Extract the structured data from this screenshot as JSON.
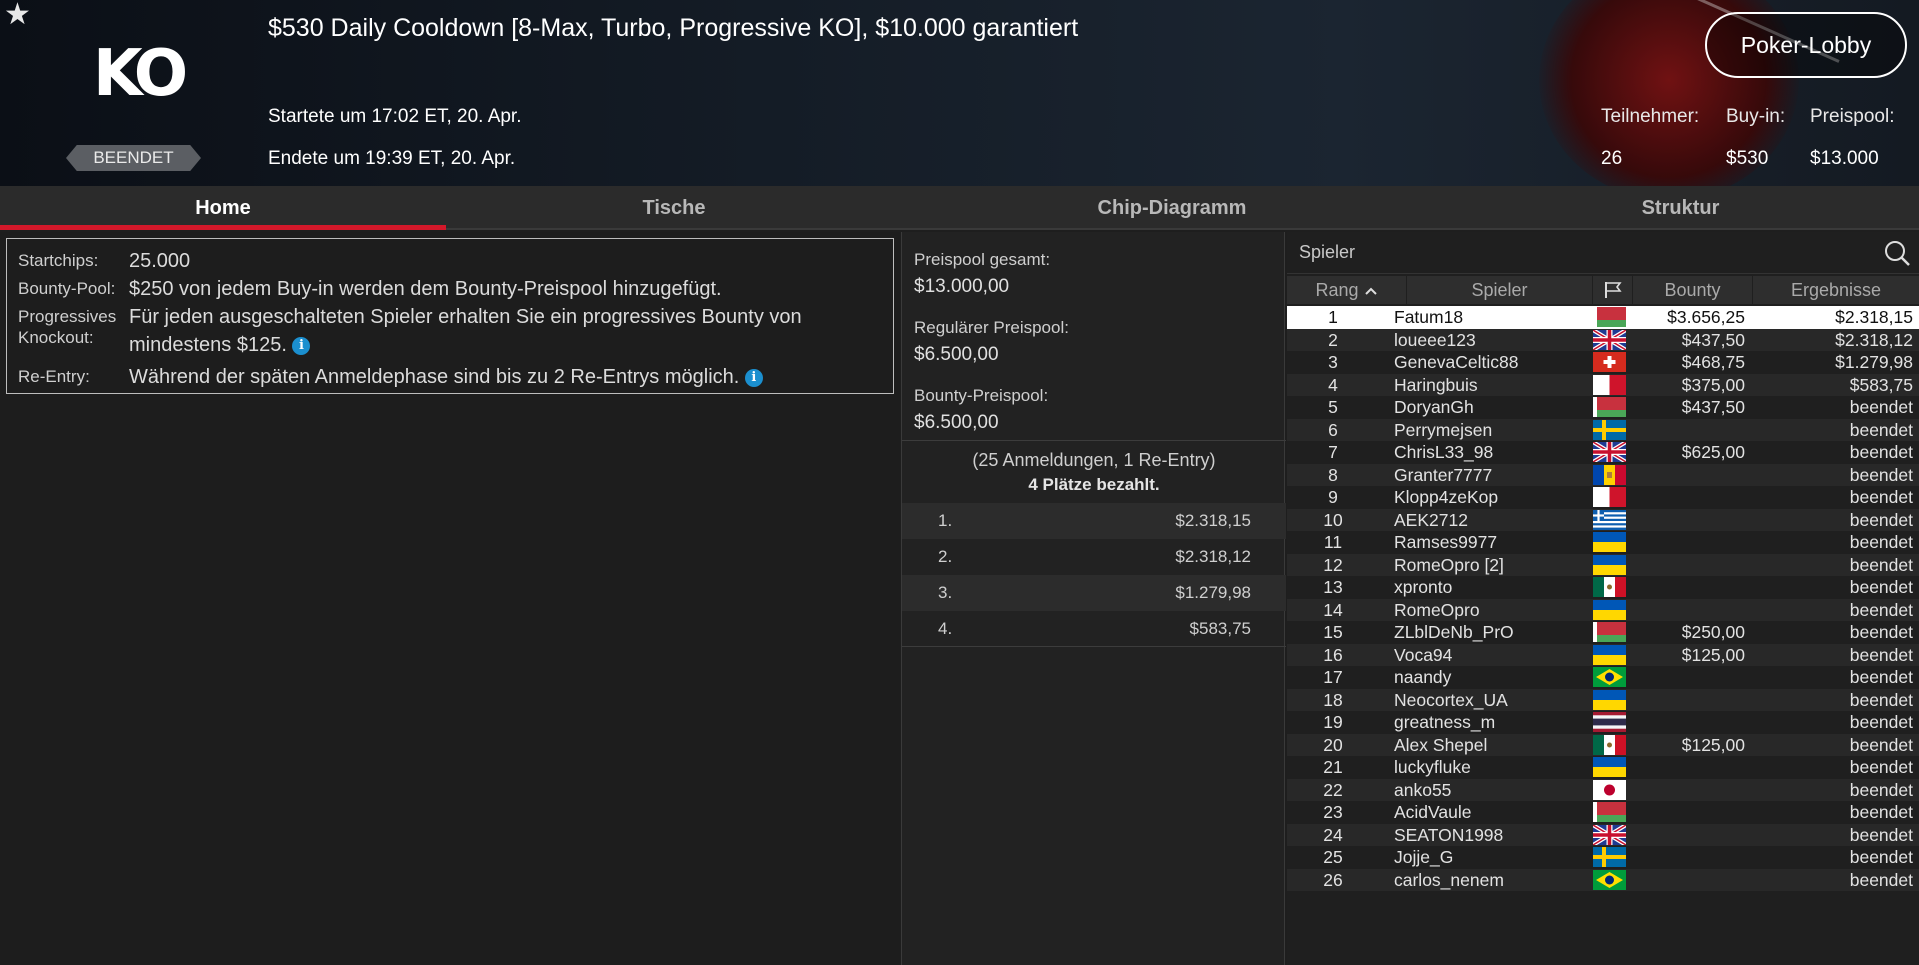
{
  "header": {
    "title": "$530 Daily Cooldown [8-Max, Turbo, Progressive KO], $10.000 garantiert",
    "logo_text": "KO",
    "status_badge": "BEENDET",
    "started": "Startete um 17:02 ET, 20. Apr.",
    "ended": "Endete um 19:39 ET, 20. Apr.",
    "lobby_button": "Poker-Lobby",
    "stats": {
      "participants_label": "Teilnehmer:",
      "participants_value": "26",
      "buyin_label": "Buy-in:",
      "buyin_value": "$530",
      "prizepool_label": "Preispool:",
      "prizepool_value": "$13.000"
    }
  },
  "tabs": [
    "Home",
    "Tische",
    "Chip-Diagramm",
    "Struktur"
  ],
  "info": {
    "startchips_label": "Startchips:",
    "startchips_value": "25.000",
    "bountypool_label": "Bounty-Pool:",
    "bountypool_value": "$250 von jedem Buy-in werden dem Bounty-Preispool hinzugefügt.",
    "pko_label_1": "Progressives",
    "pko_label_2": "Knockout:",
    "pko_value": "Für jeden ausgeschalteten Spieler erhalten Sie ein progressives Bounty von mindestens $125.",
    "reentry_label": "Re-Entry:",
    "reentry_value": "Während der späten Anmeldephase sind bis zu 2 Re-Entrys möglich.",
    "info_icon": "i"
  },
  "prizepool": {
    "total_label": "Preispool gesamt:",
    "total_value": "$13.000,00",
    "regular_label": "Regulärer Preispool:",
    "regular_value": "$6.500,00",
    "bounty_label": "Bounty-Preispool:",
    "bounty_value": "$6.500,00",
    "entries": "(25 Anmeldungen, 1 Re-Entry)",
    "paid": "4 Plätze bezahlt.",
    "payouts": [
      {
        "place": "1.",
        "amount": "$2.318,15"
      },
      {
        "place": "2.",
        "amount": "$2.318,12"
      },
      {
        "place": "3.",
        "amount": "$1.279,98"
      },
      {
        "place": "4.",
        "amount": "$583,75"
      }
    ]
  },
  "players": {
    "search_placeholder": "Spieler",
    "columns": {
      "rank": "Rang",
      "player": "Spieler",
      "bounty": "Bounty",
      "result": "Ergebnisse"
    },
    "rows": [
      {
        "rank": "1",
        "name": "Fatum18",
        "flag": "belarus",
        "bounty": "$3.656,25",
        "result": "$2.318,15"
      },
      {
        "rank": "2",
        "name": "loueee123",
        "flag": "uk",
        "bounty": "$437,50",
        "result": "$2.318,12"
      },
      {
        "rank": "3",
        "name": "GenevaCeltic88",
        "flag": "switzerland",
        "bounty": "$468,75",
        "result": "$1.279,98"
      },
      {
        "rank": "4",
        "name": "Haringbuis",
        "flag": "malta",
        "bounty": "$375,00",
        "result": "$583,75"
      },
      {
        "rank": "5",
        "name": "DoryanGh",
        "flag": "belarus",
        "bounty": "$437,50",
        "result": "beendet"
      },
      {
        "rank": "6",
        "name": "Perrymejsen",
        "flag": "sweden",
        "bounty": "",
        "result": "beendet"
      },
      {
        "rank": "7",
        "name": "ChrisL33_98",
        "flag": "uk",
        "bounty": "$625,00",
        "result": "beendet"
      },
      {
        "rank": "8",
        "name": "Granter7777",
        "flag": "moldova",
        "bounty": "",
        "result": "beendet"
      },
      {
        "rank": "9",
        "name": "Klopp4zeKop",
        "flag": "malta",
        "bounty": "",
        "result": "beendet"
      },
      {
        "rank": "10",
        "name": "AEK2712",
        "flag": "greece",
        "bounty": "",
        "result": "beendet"
      },
      {
        "rank": "11",
        "name": "Ramses9977",
        "flag": "ukraine",
        "bounty": "",
        "result": "beendet"
      },
      {
        "rank": "12",
        "name": "RomeOpro [2]",
        "flag": "ukraine",
        "bounty": "",
        "result": "beendet"
      },
      {
        "rank": "13",
        "name": "xpronto",
        "flag": "mexico",
        "bounty": "",
        "result": "beendet"
      },
      {
        "rank": "14",
        "name": "RomeOpro",
        "flag": "ukraine",
        "bounty": "",
        "result": "beendet"
      },
      {
        "rank": "15",
        "name": "ZLblDeNb_PrO",
        "flag": "belarus",
        "bounty": "$250,00",
        "result": "beendet"
      },
      {
        "rank": "16",
        "name": "Voca94",
        "flag": "ukraine",
        "bounty": "$125,00",
        "result": "beendet"
      },
      {
        "rank": "17",
        "name": "naandy",
        "flag": "brazil",
        "bounty": "",
        "result": "beendet"
      },
      {
        "rank": "18",
        "name": "Neocortex_UA",
        "flag": "ukraine",
        "bounty": "",
        "result": "beendet"
      },
      {
        "rank": "19",
        "name": "greatness_m",
        "flag": "thailand",
        "bounty": "",
        "result": "beendet"
      },
      {
        "rank": "20",
        "name": "Alex Shepel",
        "flag": "mexico",
        "bounty": "$125,00",
        "result": "beendet"
      },
      {
        "rank": "21",
        "name": "luckyfluke",
        "flag": "ukraine",
        "bounty": "",
        "result": "beendet"
      },
      {
        "rank": "22",
        "name": "anko55",
        "flag": "japan",
        "bounty": "",
        "result": "beendet"
      },
      {
        "rank": "23",
        "name": "AcidVaule",
        "flag": "belarus",
        "bounty": "",
        "result": "beendet"
      },
      {
        "rank": "24",
        "name": "SEATON1998",
        "flag": "uk",
        "bounty": "",
        "result": "beendet"
      },
      {
        "rank": "25",
        "name": "Jojje_G",
        "flag": "sweden",
        "bounty": "",
        "result": "beendet"
      },
      {
        "rank": "26",
        "name": "carlos_nenem",
        "flag": "brazil",
        "bounty": "",
        "result": "beendet"
      }
    ]
  },
  "colors": {
    "accent_red": "#d3182a",
    "info_blue": "#1b8fcf"
  }
}
